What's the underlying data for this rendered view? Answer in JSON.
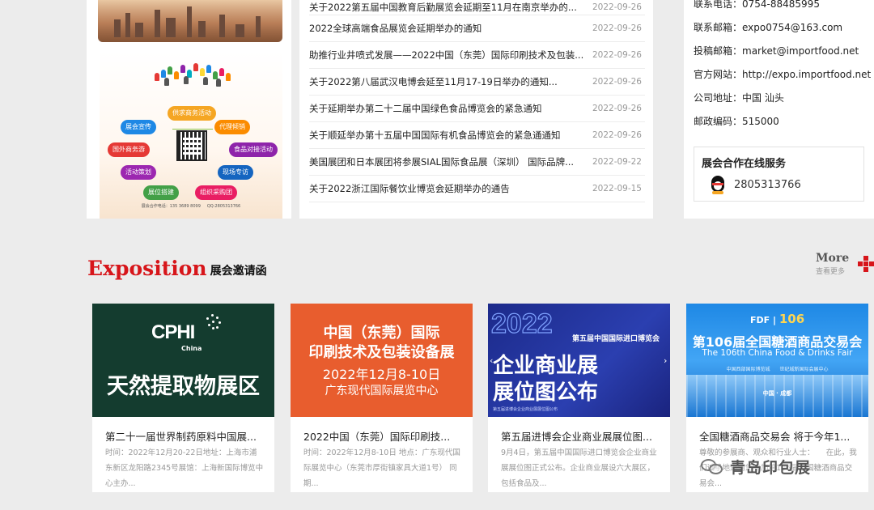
{
  "news": [
    {
      "title": "关于2022第五届中国教育后勤展览会延期至11月在南京举办的...",
      "date": "2022-09-26"
    },
    {
      "title": "2022全球高端食品展览会延期举办的通知",
      "date": "2022-09-26"
    },
    {
      "title": "助推行业井喷式发展——2022中国（东莞）国际印刷技术及包装...",
      "date": "2022-09-26"
    },
    {
      "title": "关于2022第八届武汉电博会延至11月17-19日举办的通知...",
      "date": "2022-09-26"
    },
    {
      "title": "关于延期举办第二十二届中国绿色食品博览会的紧急通知",
      "date": "2022-09-26"
    },
    {
      "title": "关于顺延举办第十五届中国国际有机食品博览会的紧急通通知",
      "date": "2022-09-26"
    },
    {
      "title": "美国展团和日本展团将参展SIAL国际食品展（深圳） 国际品牌...",
      "date": "2022-09-22"
    },
    {
      "title": "关于2022浙江国际餐饮业博览会延期举办的通告",
      "date": "2022-09-15"
    }
  ],
  "contact": {
    "phone": "联系电话：0754-88485995",
    "email": "联系邮箱：expo0754@163.com",
    "submit_email": "投稿邮箱：market@importfood.net",
    "website": "官方网站：http://expo.importfood.net",
    "address": "公司地址：中国 汕头",
    "postcode": "邮政编码：515000"
  },
  "service": {
    "title": "展会合作在线服务",
    "qq": "2805313766"
  },
  "poster": {
    "pills": [
      "供求商务活动",
      "展会宣传",
      "代理倾销",
      "国外商务游",
      "食品对接活动",
      "活动策划",
      "现场专访",
      "展位搭建",
      "组织采购团"
    ],
    "footer_left": "展会合作电话：135 3689 8099",
    "footer_right": "QQ:2805313766"
  },
  "section": {
    "title_en": "Exposition",
    "title_zh": "展会邀请函",
    "more_en": "More",
    "more_zh": "查看更多"
  },
  "cards": [
    {
      "img": {
        "brand": "CPHI",
        "brand_sub": "China",
        "big": "天然提取物展区"
      },
      "title": "第二十一届世界制药原料中国展...",
      "desc": "时间：2022年12月20-22日地址：上海市浦东新区龙阳路2345号展馆：上海新国际博览中心主办..."
    },
    {
      "img": {
        "l1": "中国（东莞）国际",
        "l2": "印刷技术及包装设备展",
        "l3": "2022年12月8-10日",
        "l4": "广东现代国际展览中心"
      },
      "title": "2022中国（东莞）国际印刷技...",
      "desc": "时间：2022年12月8-10日 地点：广东现代国际展览中心（东莞市厚街镇家具大道1号） 同期..."
    },
    {
      "img": {
        "yr": "2022",
        "edition": "第五届中国国际进口博览会",
        "t1": "企业商业展",
        "t2": "展位图公布",
        "foot": "第五届进博会企业商业展展位图公布"
      },
      "title": "第五届进博会企业商业展展位图...",
      "desc": "9月4日，第五届中国国际进口博览会企业商业展展位图正式公布。企业商业展设六大展区，包括食品及..."
    },
    {
      "img": {
        "logo": "FDF",
        "num": "106",
        "t1": "第106届全国糖酒商品交易会",
        "t2": "The 106th China Food & Drinks Fair",
        "t3": "中国西部国际博览城　　世纪城新国际会展中心",
        "t4": "中国 · 成都"
      },
      "title": "全国糖酒商品交易会 将于今年1...",
      "desc": "尊敬的参展商、观众和行业人士：　　在此，我们诚挚地邀请您参加第106届全国糖酒商品交易会..."
    }
  ],
  "watermark": "青岛印包展"
}
